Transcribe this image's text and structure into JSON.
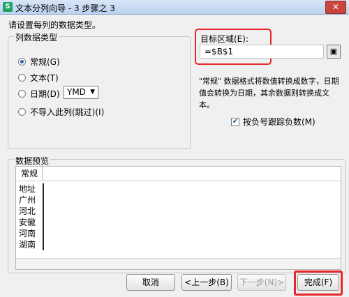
{
  "window": {
    "title": "文本分列向导 - 3 步骤之 3",
    "app_icon_letter": "S",
    "close_glyph": "✕"
  },
  "instruction": "请设置每列的数据类型。",
  "column_type": {
    "legend": "列数据类型",
    "options": [
      {
        "label": "常规(G)",
        "checked": true
      },
      {
        "label": "文本(T)",
        "checked": false
      },
      {
        "label": "日期(D)",
        "checked": false
      },
      {
        "label": "不导入此列(跳过)(I)",
        "checked": false
      }
    ],
    "date_format": "YMD"
  },
  "target": {
    "label": "目标区域(E):",
    "value": "=$B$1"
  },
  "description": "\"常规\" 数据格式将数值转换成数字，日期值会转换为日期，其余数据则转换成文本。",
  "negative_checkbox": {
    "label": "按负号跟踪负数(M)",
    "checked": true
  },
  "preview": {
    "legend": "数据预览",
    "column_header": "常规",
    "rows": [
      "地址",
      "广州",
      "河北",
      "安徽",
      "河南",
      "湖南"
    ]
  },
  "buttons": {
    "cancel": "取消",
    "back": "<上一步(B)",
    "next": "下一步(N)>",
    "finish": "完成(F)"
  },
  "colors": {
    "highlight": "#e8262a"
  }
}
